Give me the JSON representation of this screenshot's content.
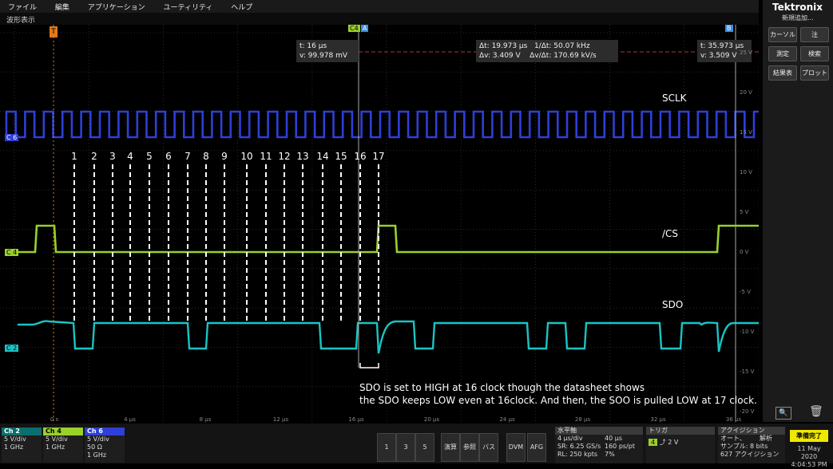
{
  "menu": {
    "items": [
      "ファイル",
      "編集",
      "アプリケーション",
      "ユーティリティ",
      "ヘルプ"
    ]
  },
  "window": {
    "title": "波形表示"
  },
  "brand": {
    "name": "Tektronix",
    "new_add": "新規追加..."
  },
  "side_buttons": [
    "カーソル",
    "注",
    "測定",
    "検索",
    "結果表",
    "プロット"
  ],
  "cursors": {
    "a_label": "A",
    "b_label": "B",
    "c4_label": "C4"
  },
  "readouts": {
    "a": {
      "t": "t: 16 µs",
      "v": "v: 99.978 mV"
    },
    "delta": {
      "dt": "Δt: 19.973 µs",
      "inv_dt": "1/Δt: 50.07 kHz",
      "dv": "Δv: 3.409 V",
      "dvdt": "Δv/Δt: 170.69 kV/s"
    },
    "b": {
      "t": "t: 35.973 µs",
      "v": "v: 3.509 V"
    }
  },
  "signals": {
    "sclk": "SCLK",
    "cs": "/CS",
    "sdo": "SDO"
  },
  "channel_tags": {
    "c6": "C 6",
    "c4": "C 4",
    "c2": "C 2"
  },
  "clock_numbers": [
    "1",
    "2",
    "3",
    "4",
    "5",
    "6",
    "7",
    "8",
    "9",
    "10",
    "11",
    "12",
    "13",
    "14",
    "15",
    "16",
    "17"
  ],
  "y_labels": [
    "25 V",
    "20 V",
    "15 V",
    "10 V",
    "5 V",
    "0 V",
    "-5 V",
    "-10 V",
    "-15 V",
    "-20 V"
  ],
  "x_labels": [
    "0 s",
    "4 µs",
    "8 µs",
    "12 µs",
    "16 µs",
    "20 µs",
    "24 µs",
    "28 µs",
    "32 µs",
    "36 µs"
  ],
  "annotation": {
    "line1": "SDO is set to HIGH at 16 clock though the datasheet shows",
    "line2": "the SDO keeps LOW even at 16clock. And then, the SOO is pulled LOW at 17 clock."
  },
  "channels": [
    {
      "name": "Ch 2",
      "l1": "5 V/div",
      "l2": "",
      "l3": "1 GHz",
      "color": "#16c2c2"
    },
    {
      "name": "Ch 4",
      "l1": "5 V/div",
      "l2": "",
      "l3": "1 GHz",
      "color": "#9ad02a"
    },
    {
      "name": "Ch 6",
      "l1": "5 V/div",
      "l2": "50 Ω",
      "l3": "1 GHz",
      "color": "#4b5ad8"
    }
  ],
  "bottom_buttons": [
    "1",
    "3",
    "5",
    "演算",
    "参照",
    "バス",
    "DVM",
    "AFG"
  ],
  "horizontal": {
    "title": "水平軸",
    "r1a": "4 µs/div",
    "r1b": "40 µs",
    "r2a": "SR: 6.25 GS/s",
    "r2b": "160 ps/pt",
    "r3a": "RL: 250 kpts",
    "r3b": "7%"
  },
  "trigger": {
    "title": "トリガ",
    "ch": "4",
    "level": "2 V"
  },
  "acquisition": {
    "title": "アクイジション",
    "r1a": "オート、",
    "r1b": "解析",
    "r2": "サンプル: 8 bits",
    "r3": "627 アクイジション"
  },
  "status": {
    "ready": "準備完了",
    "date": "11 May 2020",
    "time": "4:04:53 PM"
  },
  "colors": {
    "sclk": "#2f3fd8",
    "cs": "#9ad02a",
    "sdo": "#19c4c4",
    "cursor_a": "#3a8fe0",
    "cursor_b": "#3a8fe0",
    "accent": "#f0e800"
  }
}
